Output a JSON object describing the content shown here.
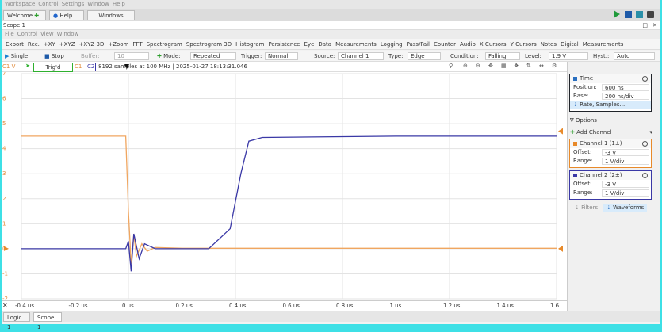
{
  "menubar": [
    "Workspace",
    "Control",
    "Settings",
    "Window",
    "Help"
  ],
  "tabs": {
    "welcome": "Welcome",
    "help": "Help",
    "windows": "Windows"
  },
  "scope_title": "Scope 1",
  "submenu": [
    "File",
    "Control",
    "View",
    "Window"
  ],
  "toolbar1": [
    "Export",
    "Rec.",
    "+XY",
    "+XYZ",
    "+XYZ 3D",
    "+Zoom",
    "FFT",
    "Spectrogram",
    "Spectrogram 3D",
    "Histogram",
    "Persistence",
    "Eye",
    "Data",
    "Measurements",
    "Logging",
    "Pass/Fail",
    "Counter",
    "Audio",
    "X Cursors",
    "Y Cursors",
    "Notes",
    "Digital",
    "Measurements"
  ],
  "toolbar2": {
    "single": "Single",
    "stop": "Stop",
    "buffer_label": "Buffer:",
    "buffer_value": "10",
    "mode_label": "Mode:",
    "mode_value": "Repeated",
    "trigger_label": "Trigger:",
    "trigger_value": "Normal",
    "source_label": "Source:",
    "source_value": "Channel 1",
    "type_label": "Type:",
    "type_value": "Edge",
    "condition_label": "Condition:",
    "condition_value": "Falling",
    "level_label": "Level:",
    "level_value": "1.9 V",
    "hyst_label": "Hyst.:",
    "hyst_value": "Auto"
  },
  "plotbar": {
    "unit": "C1 V",
    "status": "Trig'd",
    "c1": "C1",
    "c2": "C2",
    "info": "8192 samples at 100 MHz | 2025-01-27 18:13:31.046"
  },
  "y_labels": [
    "7",
    "6",
    "5",
    "4",
    "3",
    "2",
    "1",
    "0",
    "-1",
    "-2"
  ],
  "x_labels": [
    "-0.4 us",
    "-0.2 us",
    "0 us",
    "0.2 us",
    "0.4 us",
    "0.6 us",
    "0.8 us",
    "1 us",
    "1.2 us",
    "1.4 us",
    "1.6 us"
  ],
  "time_panel": {
    "title": "Time",
    "position_label": "Position:",
    "position_value": "600 ns",
    "base_label": "Base:",
    "base_value": "200 ns/div",
    "rate_label": "Rate, Samples..."
  },
  "options": "Options",
  "add_channel": "Add Channel",
  "ch1_panel": {
    "title": "Channel 1 (1±)",
    "offset_label": "Offset:",
    "offset_value": "-3 V",
    "range_label": "Range:",
    "range_value": "1 V/div"
  },
  "ch2_panel": {
    "title": "Channel 2 (2±)",
    "offset_label": "Offset:",
    "offset_value": "-3 V",
    "range_label": "Range:",
    "range_value": "1 V/div"
  },
  "bottom_panel": {
    "filters": "Filters",
    "waveforms": "Waveforms"
  },
  "bottom_tabs": {
    "logic": "Logic 1",
    "scope": "Scope 1"
  },
  "colors": {
    "ch1": "#f0a660",
    "ch2": "#3a38a6",
    "trig": "#2fb02f"
  },
  "chart_data": {
    "type": "line",
    "x_unit": "us",
    "xlim": [
      -0.4,
      1.6
    ],
    "ylim": [
      -2,
      7
    ],
    "series": [
      {
        "color": "#f0a660",
        "x": [
          -0.4,
          -0.01,
          0.0,
          0.01,
          0.02,
          0.03,
          0.05,
          0.07,
          0.1,
          0.2,
          1.6
        ],
        "y": [
          4.5,
          4.5,
          1.5,
          -0.6,
          0.6,
          -0.3,
          0.2,
          -0.1,
          0.05,
          0.02,
          0.02
        ]
      },
      {
        "color": "#3a38a6",
        "x": [
          -0.4,
          -0.01,
          0.0,
          0.01,
          0.02,
          0.04,
          0.06,
          0.1,
          0.3,
          0.38,
          0.42,
          0.45,
          0.5,
          1.0,
          1.6
        ],
        "y": [
          0,
          0,
          0.3,
          -0.9,
          0.6,
          -0.4,
          0.2,
          0.0,
          0.0,
          0.8,
          3.0,
          4.3,
          4.45,
          4.5,
          4.5
        ]
      }
    ]
  }
}
